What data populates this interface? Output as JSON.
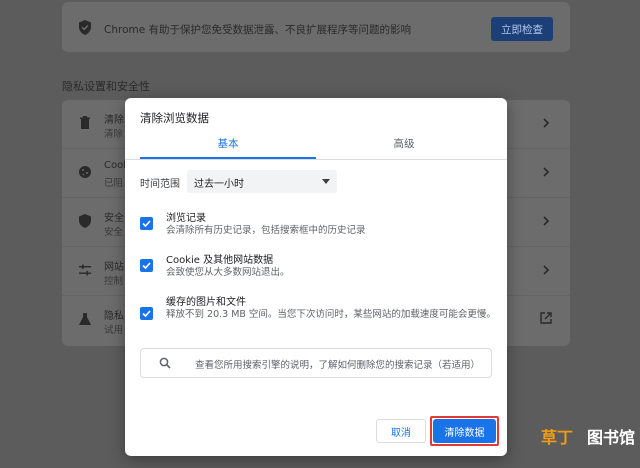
{
  "safety_check": {
    "text": "Chrome 有助于保护您免受数据泄露、不良扩展程序等问题的影响",
    "button_label": "立即检查",
    "icon": "shield-check-icon"
  },
  "privacy_section": {
    "title": "隐私设置和安全性",
    "rows": [
      {
        "title": "清除",
        "subtitle": "清除",
        "icon": "trash-icon"
      },
      {
        "title": "Cook",
        "subtitle": "已阻",
        "icon": "cookie-icon"
      },
      {
        "title": "安全",
        "subtitle": "安全",
        "icon": "shield-icon"
      },
      {
        "title": "网站",
        "subtitle": "控制",
        "icon": "sliders-icon"
      },
      {
        "title": "隐私",
        "subtitle": "试用",
        "icon": "flask-icon"
      }
    ]
  },
  "dialog": {
    "title": "清除浏览数据",
    "tabs": [
      {
        "label": "基本",
        "active": true
      },
      {
        "label": "高级",
        "active": false
      }
    ],
    "time_range": {
      "label": "时间范围",
      "value": "过去一小时"
    },
    "options": [
      {
        "title": "浏览记录",
        "description": "会清除所有历史记录，包括搜索框中的历史记录",
        "checked": true
      },
      {
        "title": "Cookie 及其他网站数据",
        "description": "会致使您从大多数网站退出。",
        "checked": true
      },
      {
        "title": "缓存的图片和文件",
        "description": "释放不到 20.3 MB 空间。当您下次访问时，某些网站的加载速度可能会更慢。",
        "checked": true
      }
    ],
    "search_info": "查看您所用搜索引擎的说明，了解如何删除您的搜索记录（若适用）",
    "cancel_label": "取消",
    "clear_label": "清除数据"
  },
  "watermark": {
    "part1": "草丁",
    "part2": "图书馆"
  },
  "colors": {
    "accent": "#1a73e8",
    "highlight": "#e53935",
    "overlay": "#5c5c5c"
  }
}
